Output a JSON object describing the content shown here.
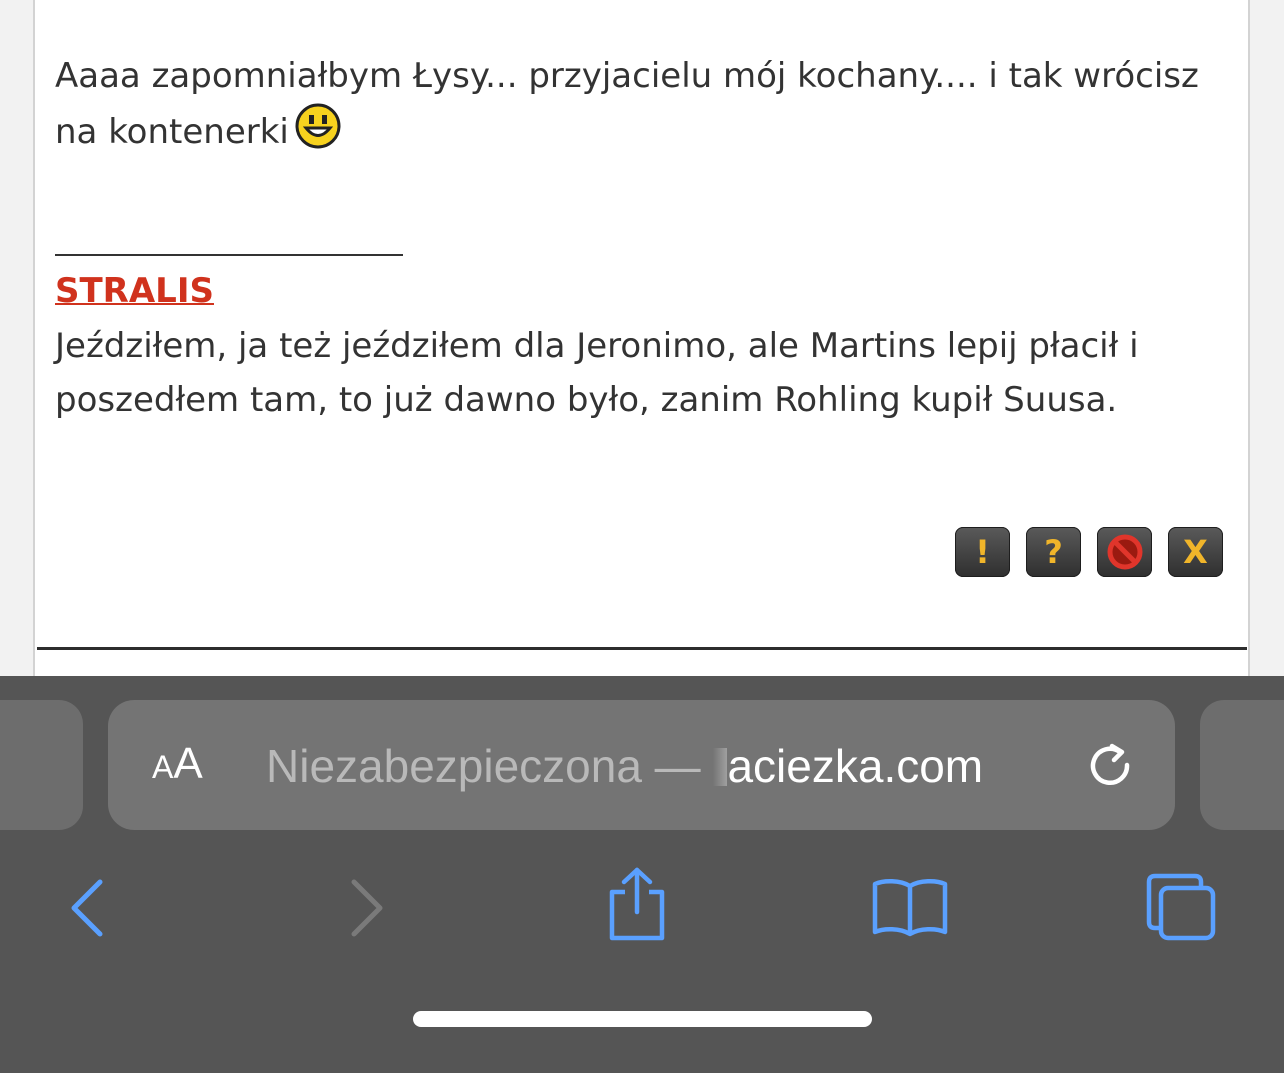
{
  "post": {
    "paragraph1": "Aaaa zapomniałbym Łysy... przyjacielu mój kochany.... i tak wrócisz na kontenerki",
    "signature_link": "STRALIS",
    "paragraph2": "Jeździłem, ja też jeździłem dla Jeronimo, ale Martins lepij płacił i poszedłem tam, to już dawno było, zanim Rohling kupił Suusa."
  },
  "action_buttons": [
    {
      "name": "report-button",
      "glyph": "!"
    },
    {
      "name": "help-button",
      "glyph": "?"
    },
    {
      "name": "block-button",
      "glyph": ""
    },
    {
      "name": "delete-button",
      "glyph": "X"
    }
  ],
  "browser": {
    "reader_small": "A",
    "reader_big": "A",
    "url_prefix": "Niezabezpieczona — ",
    "url_domain": "aciezka.com",
    "accent_color": "#5aa0ff",
    "toolbar_bg": "#555555"
  }
}
